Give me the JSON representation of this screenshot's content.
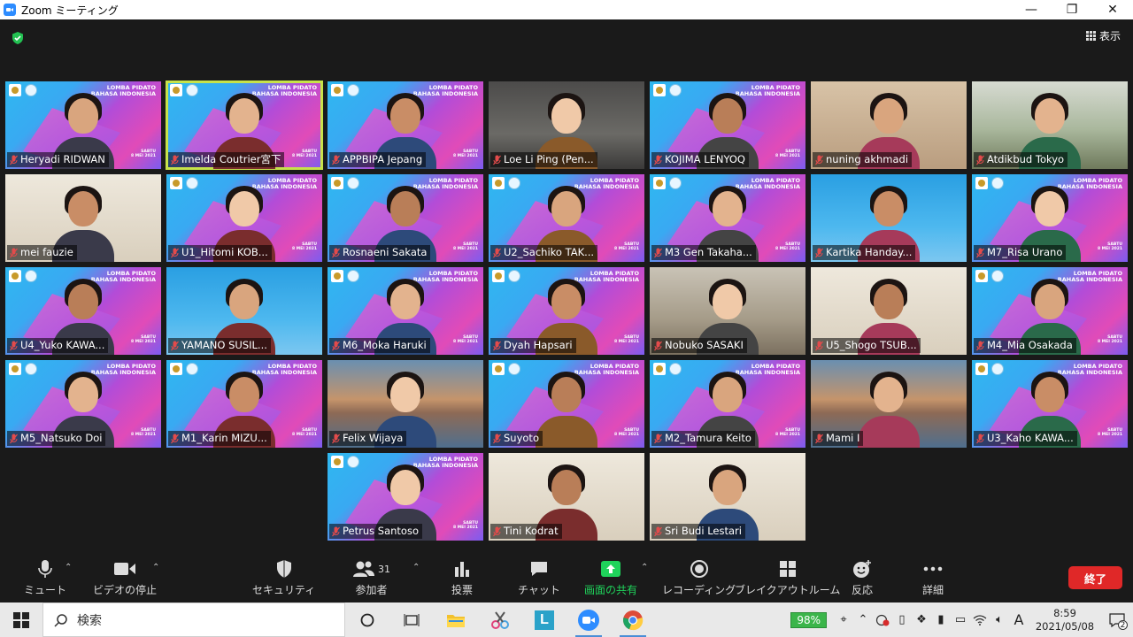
{
  "window": {
    "title": "Zoom ミーティング",
    "minimize": "—",
    "restore": "❐",
    "close": "✕"
  },
  "view_label": "表示",
  "participants": [
    {
      "name": "Heryadi RIDWAN",
      "bg": "banner"
    },
    {
      "name": "Imelda Coutrier宮下",
      "bg": "banner",
      "active": true
    },
    {
      "name": "APPBIPA Jepang",
      "bg": "banner"
    },
    {
      "name": "Loe Li Ping (Pen...",
      "bg": "room2"
    },
    {
      "name": "KOJIMA LENYOQ",
      "bg": "banner"
    },
    {
      "name": "nuning akhmadi",
      "bg": "warm"
    },
    {
      "name": "Atdikbud Tokyo",
      "bg": "window"
    },
    {
      "name": "mei fauzie",
      "bg": "light"
    },
    {
      "name": "U1_Hitomi KOB...",
      "bg": "banner"
    },
    {
      "name": "Rosnaeni Sakata",
      "bg": "banner"
    },
    {
      "name": "U2_Sachiko TAK...",
      "bg": "banner"
    },
    {
      "name": "M3 Gen Takaha...",
      "bg": "banner"
    },
    {
      "name": "Kartika Handay...",
      "bg": "blue"
    },
    {
      "name": "M7_Risa Urano",
      "bg": "banner"
    },
    {
      "name": "U4_Yuko KAWA...",
      "bg": "banner"
    },
    {
      "name": "YAMANO SUSIL...",
      "bg": "blue"
    },
    {
      "name": "M6_Moka Haruki",
      "bg": "banner"
    },
    {
      "name": "Dyah Hapsari",
      "bg": "banner"
    },
    {
      "name": "Nobuko SASAKI",
      "bg": "room"
    },
    {
      "name": "U5_Shogo TSUB...",
      "bg": "light"
    },
    {
      "name": "M4_Mia Osakada",
      "bg": "banner"
    },
    {
      "name": "M5_Natsuko Doi",
      "bg": "banner"
    },
    {
      "name": "M1_Karin MIZU...",
      "bg": "banner"
    },
    {
      "name": "Felix Wijaya",
      "bg": "bridge"
    },
    {
      "name": "Suyoto",
      "bg": "banner"
    },
    {
      "name": "M2_Tamura Keito",
      "bg": "banner"
    },
    {
      "name": "Mami I",
      "bg": "bridge"
    },
    {
      "name": "U3_Kaho KAWA...",
      "bg": "banner"
    },
    {
      "name": "Petrus Santoso",
      "bg": "banner"
    },
    {
      "name": "Tini Kodrat",
      "bg": "light"
    },
    {
      "name": "Sri Budi Lestari",
      "bg": "light"
    }
  ],
  "banner": {
    "line1": "LOMBA PIDATO",
    "line2": "BAHASA INDONESIA",
    "day": "SABTU",
    "date": "8 MEI 2021"
  },
  "toolbar": {
    "mute": "ミュート",
    "video": "ビデオの停止",
    "security": "セキュリティ",
    "participants": "参加者",
    "participants_count": "31",
    "poll": "投票",
    "chat": "チャット",
    "share": "画面の共有",
    "record": "レコーディング",
    "breakout": "ブレイクアウトルーム",
    "reactions": "反応",
    "more": "詳細",
    "end": "終了"
  },
  "taskbar": {
    "search_placeholder": "検索",
    "battery": "98%",
    "time": "8:59",
    "date": "2021/05/08",
    "notif_count": "2",
    "ime": "A"
  },
  "colors": {
    "accent_green": "#1fd35b",
    "end_red": "#e02828",
    "active_outline": "#c7e24a"
  }
}
